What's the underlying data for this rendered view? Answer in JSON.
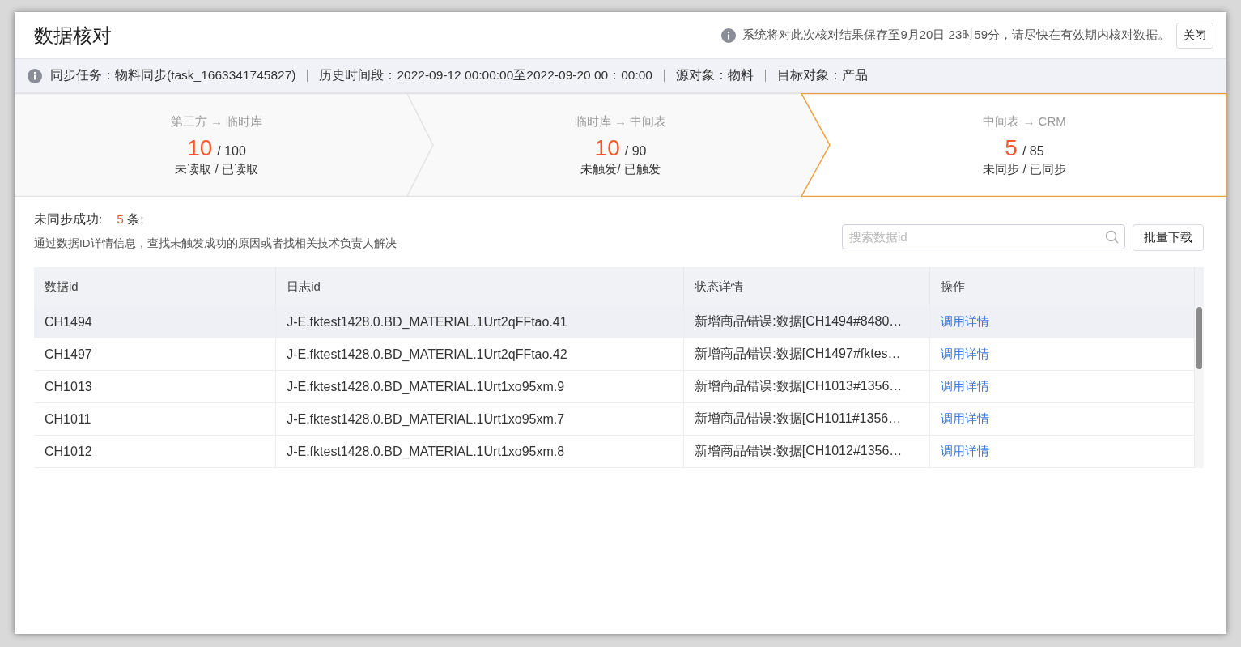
{
  "header": {
    "title": "数据核对",
    "notice": "系统将对此次核对结果保存至9月20日 23时59分，请尽快在有效期内核对数据。",
    "close_button": "关闭"
  },
  "info_bar": {
    "items": [
      "同步任务：物料同步(task_1663341745827)",
      "历史时间段：2022-09-12 00:00:00至2022-09-20 00：00:00",
      "源对象：物料",
      "目标对象：产品"
    ]
  },
  "steps": [
    {
      "route": "第三方 → 临时库",
      "count": "10",
      "total": "/ 100",
      "caption": "未读取 / 已读取",
      "selected": false
    },
    {
      "route": "临时库 → 中间表",
      "count": "10",
      "total": "/ 90",
      "caption": "未触发/ 已触发",
      "selected": false
    },
    {
      "route": "中间表 → CRM",
      "count": "5",
      "total": "/ 85",
      "caption": "未同步 /  已同步",
      "selected": true
    }
  ],
  "summary": {
    "label": "未同步成功:",
    "count": "5",
    "unit": "条;",
    "hint": "通过数据ID详情信息，查找未触发成功的原因或者找相关技术负责人解决"
  },
  "search": {
    "placeholder": "搜索数据id"
  },
  "download_button": "批量下载",
  "table": {
    "columns": [
      "数据id",
      "日志id",
      "状态详情",
      "操作"
    ],
    "rows": [
      {
        "cells": [
          "CH1494",
          "J-E.fktest1428.0.BD_MATERIAL.1Urt2qFFtao.41",
          "新增商品错误:数据[CH1494#8480…"
        ],
        "action": "调用详情",
        "selected": true
      },
      {
        "cells": [
          "CH1497",
          "J-E.fktest1428.0.BD_MATERIAL.1Urt2qFFtao.42",
          "新增商品错误:数据[CH1497#fktes…"
        ],
        "action": "调用详情",
        "selected": false
      },
      {
        "cells": [
          "CH1013",
          "J-E.fktest1428.0.BD_MATERIAL.1Urt1xo95xm.9",
          "新增商品错误:数据[CH1013#1356…"
        ],
        "action": "调用详情",
        "selected": false
      },
      {
        "cells": [
          "CH1011",
          "J-E.fktest1428.0.BD_MATERIAL.1Urt1xo95xm.7",
          "新增商品错误:数据[CH1011#1356…"
        ],
        "action": "调用详情",
        "selected": false
      },
      {
        "cells": [
          "CH1012",
          "J-E.fktest1428.0.BD_MATERIAL.1Urt1xo95xm.8",
          "新增商品错误:数据[CH1012#1356…"
        ],
        "action": "调用详情",
        "selected": false
      }
    ]
  }
}
